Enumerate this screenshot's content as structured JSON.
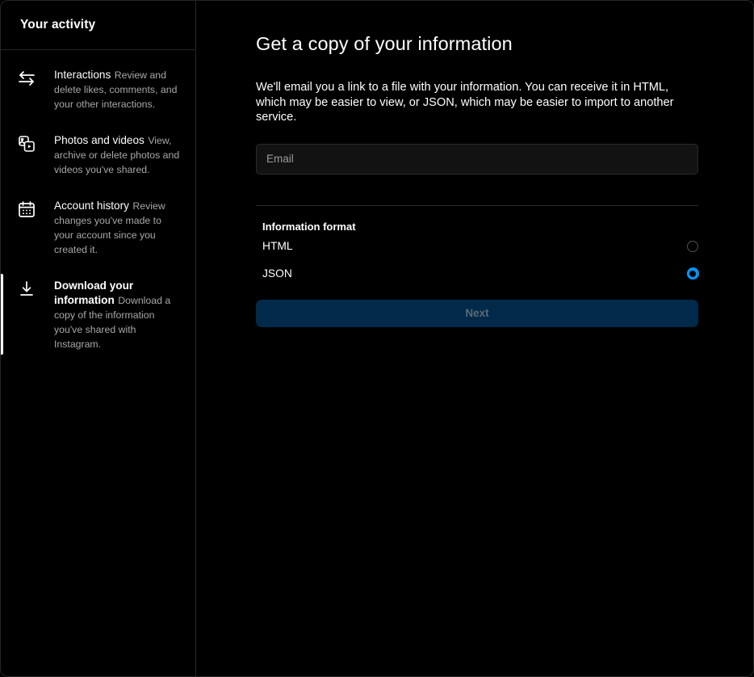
{
  "sidebar": {
    "header_title": "Your activity",
    "items": [
      {
        "icon": "interactions-arrows-icon",
        "title": "Interactions",
        "description": "Review and delete likes, comments, and your other interactions.",
        "active": false
      },
      {
        "icon": "photos-videos-icon",
        "title": "Photos and videos",
        "description": "View, archive or delete photos and videos you've shared.",
        "active": false
      },
      {
        "icon": "calendar-icon",
        "title": "Account history",
        "description": "Review changes you've made to your account since you created it.",
        "active": false
      },
      {
        "icon": "download-icon",
        "title": "Download your information",
        "description": "Download a copy of the information you've shared with Instagram.",
        "active": true
      }
    ]
  },
  "main": {
    "heading": "Get a copy of your information",
    "description": "We'll email you a link to a file with your information. You can receive it in HTML, which may be easier to view, or JSON, which may be easier to import to another service.",
    "email_field": {
      "placeholder": "Email",
      "value": ""
    },
    "format_section": {
      "label": "Information format",
      "options": [
        {
          "label": "HTML",
          "selected": false
        },
        {
          "label": "JSON",
          "selected": true
        }
      ]
    },
    "next_button_label": "Next"
  },
  "colors": {
    "background": "#000000",
    "border": "#262626",
    "accent_blue": "#0095f6",
    "button_disabled_bg": "#00294a",
    "button_disabled_text": "#5b6a75",
    "secondary_text": "#a8a8a8"
  }
}
